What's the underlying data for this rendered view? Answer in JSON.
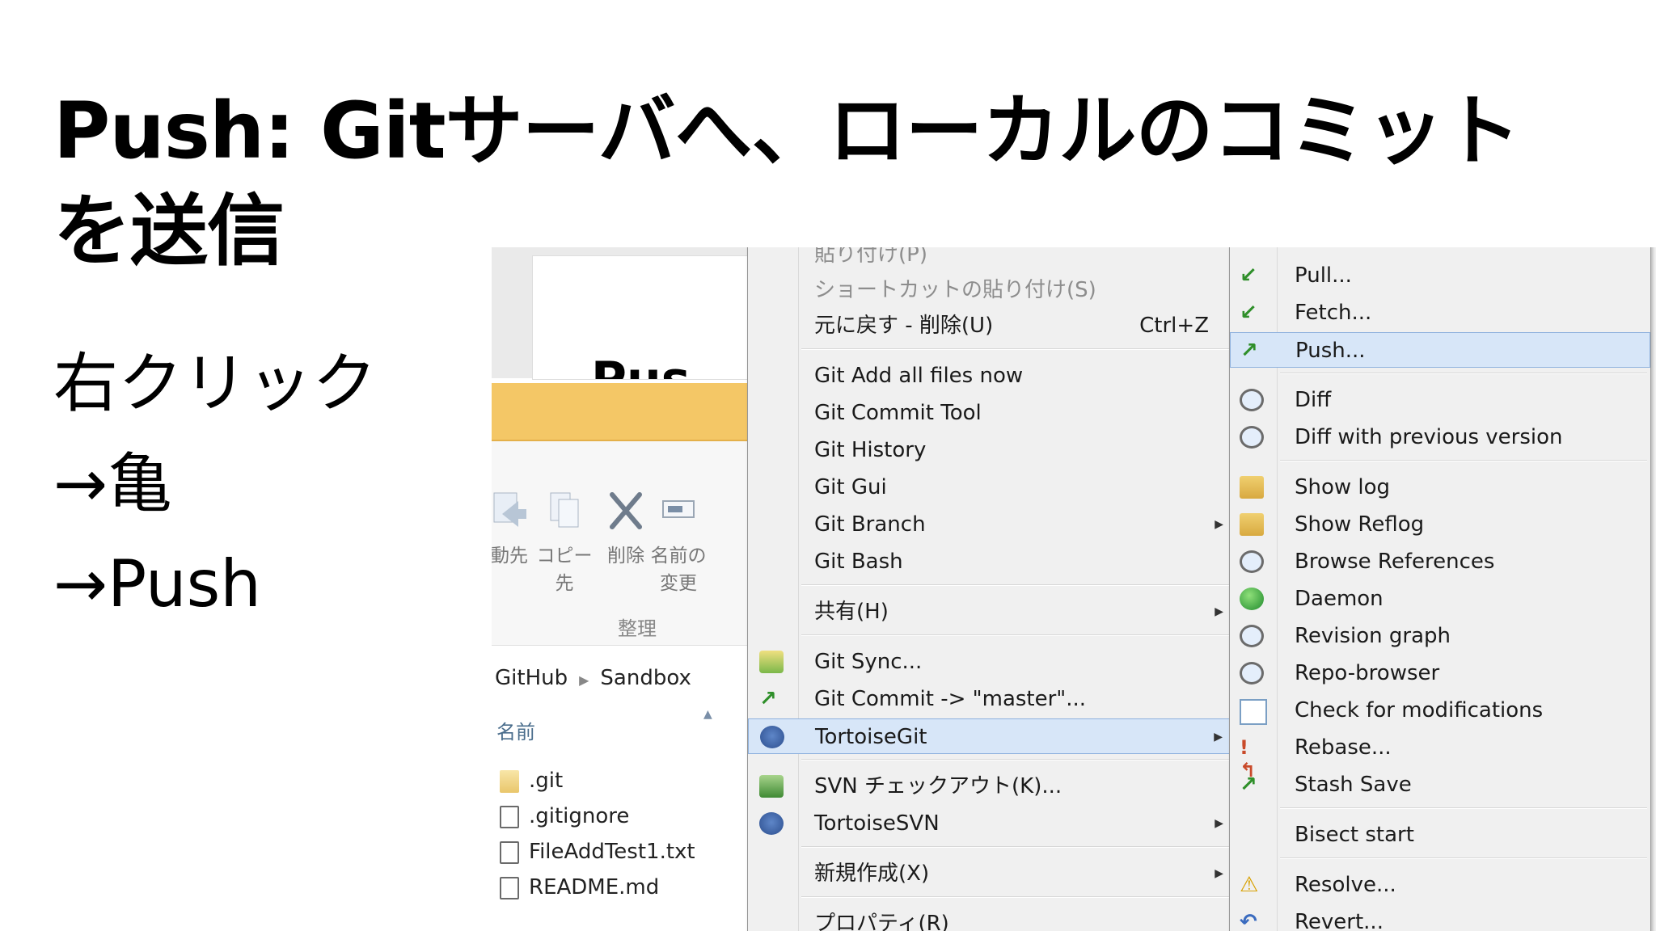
{
  "slide": {
    "title": "Push: Gitサーバへ、ローカルのコミットを送信",
    "bullets": [
      "右クリック",
      "→亀",
      "→Push"
    ]
  },
  "explorer": {
    "preview_text": "Pus",
    "ribbon_buttons": [
      "動先",
      "コピー先",
      "削除",
      "名前の変更"
    ],
    "ribbon_group": "整理",
    "breadcrumb": [
      "GitHub",
      "Sandbox"
    ],
    "column_header": "名前",
    "files": [
      ".git",
      ".gitignore",
      "FileAddTest1.txt",
      "README.md"
    ]
  },
  "context_menu": {
    "items": [
      {
        "label": "貼り付け(P)",
        "disabled": true
      },
      {
        "label": "ショートカットの貼り付け(S)",
        "disabled": true
      },
      {
        "label": "元に戻す - 削除(U)",
        "shortcut": "Ctrl+Z"
      },
      {
        "label": "Git Add all files now"
      },
      {
        "label": "Git Commit Tool"
      },
      {
        "label": "Git History"
      },
      {
        "label": "Git Gui"
      },
      {
        "label": "Git Branch",
        "submenu": true
      },
      {
        "label": "Git Bash"
      },
      {
        "label": "共有(H)",
        "submenu": true
      },
      {
        "label": "Git Sync..."
      },
      {
        "label": "Git Commit -> \"master\"..."
      },
      {
        "label": "TortoiseGit",
        "submenu": true,
        "highlighted": true
      },
      {
        "label": "SVN チェックアウト(K)..."
      },
      {
        "label": "TortoiseSVN",
        "submenu": true
      },
      {
        "label": "新規作成(X)",
        "submenu": true
      },
      {
        "label": "プロパティ(R)"
      }
    ]
  },
  "tortoisegit_menu": {
    "items": [
      {
        "label": "Pull...",
        "icon": "pull-icon"
      },
      {
        "label": "Fetch...",
        "icon": "fetch-icon"
      },
      {
        "label": "Push...",
        "icon": "push-icon",
        "highlighted": true
      },
      {
        "label": "Diff",
        "icon": "diff-icon"
      },
      {
        "label": "Diff with previous version",
        "icon": "diff-previous-icon"
      },
      {
        "label": "Show log",
        "icon": "show-log-icon"
      },
      {
        "label": "Show Reflog",
        "icon": "show-reflog-icon"
      },
      {
        "label": "Browse References",
        "icon": "browse-references-icon"
      },
      {
        "label": "Daemon",
        "icon": "daemon-icon"
      },
      {
        "label": "Revision graph",
        "icon": "revision-graph-icon"
      },
      {
        "label": "Repo-browser",
        "icon": "repo-browser-icon"
      },
      {
        "label": "Check for modifications",
        "icon": "check-modifications-icon"
      },
      {
        "label": "Rebase...",
        "icon": "rebase-icon"
      },
      {
        "label": "Stash Save",
        "icon": "stash-save-icon"
      },
      {
        "label": "Bisect start",
        "icon": ""
      },
      {
        "label": "Resolve...",
        "icon": "resolve-icon"
      },
      {
        "label": "Revert...",
        "icon": "revert-icon"
      }
    ]
  }
}
